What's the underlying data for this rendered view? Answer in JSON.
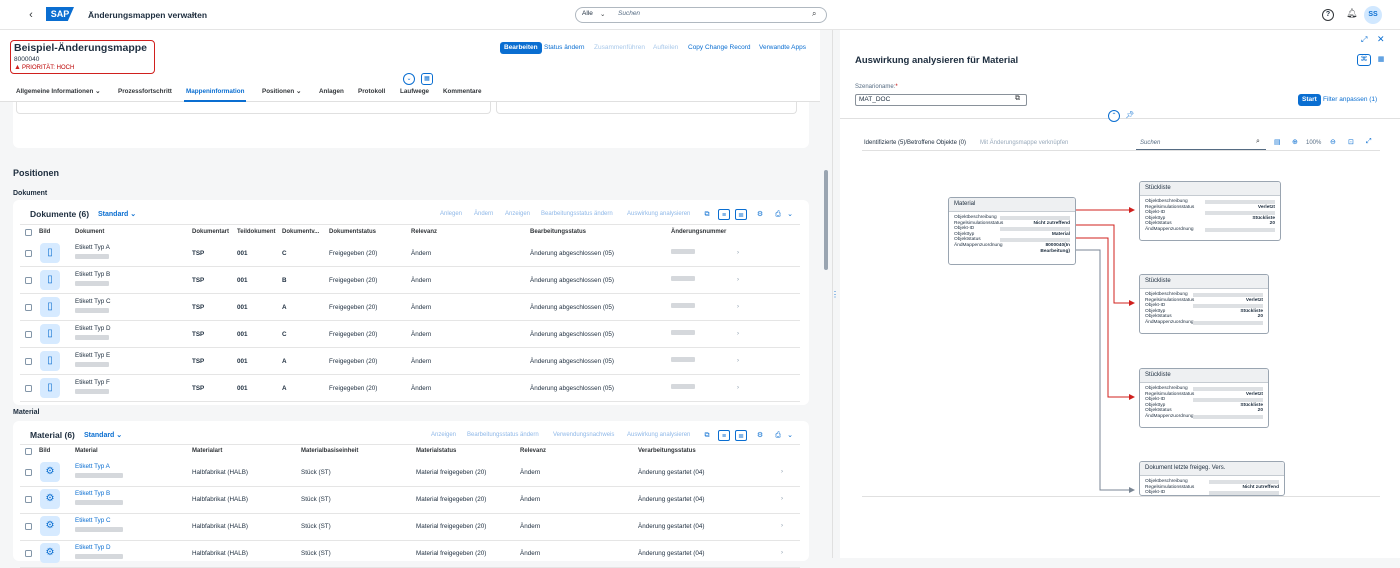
{
  "shell": {
    "app_title": "Änderungsmappen verwalten",
    "search_scope": "Alle",
    "search_placeholder": "Suchen",
    "avatar": "SS",
    "logo": "SAP"
  },
  "header": {
    "title": "Beispiel-Änderungsmappe",
    "number": "8000040",
    "priority": "PRIORITÄT: HOCH",
    "actions": [
      "Bearbeiten",
      "Status ändern",
      "Zusammenführen",
      "Aufteilen",
      "Copy Change Record",
      "Verwandte Apps"
    ]
  },
  "tabs": [
    "Allgemeine Informationen",
    "Prozessfortschritt",
    "Mappeninformation",
    "Positionen",
    "Anlagen",
    "Protokoll",
    "Laufwege",
    "Kommentare"
  ],
  "positions": {
    "section_title": "Positionen",
    "doc_subtitle": "Dokument",
    "mat_subtitle": "Material"
  },
  "documents": {
    "title": "Dokumente (6)",
    "variant": "Standard",
    "actions": [
      "Anlegen",
      "Ändern",
      "Anzeigen",
      "Bearbeitungsstatus ändern",
      "Auswirkung analysieren"
    ],
    "columns": [
      "Bild",
      "Dokument",
      "Dokumentart",
      "Teildokument",
      "Dokumentv...",
      "Dokumentstatus",
      "Relevanz",
      "Bearbeitungsstatus",
      "Änderungsnummer"
    ],
    "rows": [
      {
        "name": "Etikett Typ A",
        "art": "TSP",
        "teil": "001",
        "version": "C",
        "status": "Freigegeben (20)",
        "relevanz": "Ändern",
        "bearb": "Änderung abgeschlossen (05)"
      },
      {
        "name": "Etikett Typ B",
        "art": "TSP",
        "teil": "001",
        "version": "B",
        "status": "Freigegeben (20)",
        "relevanz": "Ändern",
        "bearb": "Änderung abgeschlossen (05)"
      },
      {
        "name": "Etikett Typ C",
        "art": "TSP",
        "teil": "001",
        "version": "A",
        "status": "Freigegeben (20)",
        "relevanz": "Ändern",
        "bearb": "Änderung abgeschlossen (05)"
      },
      {
        "name": "Etikett Typ D",
        "art": "TSP",
        "teil": "001",
        "version": "C",
        "status": "Freigegeben (20)",
        "relevanz": "Ändern",
        "bearb": "Änderung abgeschlossen (05)"
      },
      {
        "name": "Etikett Typ E",
        "art": "TSP",
        "teil": "001",
        "version": "A",
        "status": "Freigegeben (20)",
        "relevanz": "Ändern",
        "bearb": "Änderung abgeschlossen (05)"
      },
      {
        "name": "Etikett Typ F",
        "art": "TSP",
        "teil": "001",
        "version": "A",
        "status": "Freigegeben (20)",
        "relevanz": "Ändern",
        "bearb": "Änderung abgeschlossen (05)"
      }
    ]
  },
  "materials": {
    "title": "Material (6)",
    "variant": "Standard",
    "actions": [
      "Anzeigen",
      "Bearbeitungsstatus ändern",
      "Verwendungsnachweis",
      "Auswirkung analysieren"
    ],
    "columns": [
      "Bild",
      "Material",
      "Materialart",
      "Materialbasiseinheit",
      "Materialstatus",
      "Relevanz",
      "Verarbeitungsstatus"
    ],
    "rows": [
      {
        "name": "Etikett Typ A",
        "art": "Halbfabrikat (HALB)",
        "unit": "Stück (ST)",
        "status": "Material freigegeben (20)",
        "relevanz": "Ändern",
        "proc": "Änderung gestartet (04)"
      },
      {
        "name": "Etikett Typ B",
        "art": "Halbfabrikat (HALB)",
        "unit": "Stück (ST)",
        "status": "Material freigegeben (20)",
        "relevanz": "Ändern",
        "proc": "Änderung gestartet (04)"
      },
      {
        "name": "Etikett Typ C",
        "art": "Halbfabrikat (HALB)",
        "unit": "Stück (ST)",
        "status": "Material freigegeben (20)",
        "relevanz": "Ändern",
        "proc": "Änderung gestartet (04)"
      },
      {
        "name": "Etikett Typ D",
        "art": "Halbfabrikat (HALB)",
        "unit": "Stück (ST)",
        "status": "Material freigegeben (20)",
        "relevanz": "Ändern",
        "proc": "Änderung gestartet (04)"
      }
    ]
  },
  "impact": {
    "title": "Auswirkung analysieren für Material",
    "scenario_label": "Szenarioname:",
    "scenario_required": "*",
    "scenario_value": "MAT_DOC",
    "start": "Start",
    "filter": "Filter anpassen (1)",
    "tab_identified": "Identifizierte (5)/Betroffene Objekte (0)",
    "tab_link": "Mit Änderungsmappe verknüpfen",
    "graph_search": "Suchen",
    "zoom": "100%",
    "nodes": {
      "material": {
        "title": "Material",
        "rows": [
          {
            "label": "Objektbeschreibung",
            "value": ""
          },
          {
            "label": "Regelsimulationsstatus",
            "value": "Nicht zutreffend"
          },
          {
            "label": "Objekt-ID",
            "value": ""
          },
          {
            "label": "Objekttyp",
            "value": "Material"
          },
          {
            "label": "Objektstatus",
            "value": ""
          },
          {
            "label": "ÄndMappenzuordnung",
            "value": "8000040(In"
          },
          {
            "label": "",
            "value": "Bearbeitung)"
          }
        ]
      },
      "bom1": {
        "title": "Stückliste",
        "rows": [
          {
            "label": "Objektbeschreibung",
            "value": ""
          },
          {
            "label": "Regelsimulationsstatus",
            "value": "Verletzt"
          },
          {
            "label": "Objekt-ID",
            "value": ""
          },
          {
            "label": "Objekttyp",
            "value": "Stückliste"
          },
          {
            "label": "Objektstatus",
            "value": "20"
          },
          {
            "label": "ÄndMappenzuordnung",
            "value": ""
          }
        ]
      },
      "bom2": {
        "title": "Stückliste",
        "rows": [
          {
            "label": "Objektbeschreibung",
            "value": ""
          },
          {
            "label": "Regelsimulationsstatus",
            "value": "Verletzt"
          },
          {
            "label": "Objekt-ID",
            "value": ""
          },
          {
            "label": "Objekttyp",
            "value": "Stückliste"
          },
          {
            "label": "Objektstatus",
            "value": "20"
          },
          {
            "label": "ÄndMappenzuordnung",
            "value": ""
          }
        ]
      },
      "bom3": {
        "title": "Stückliste",
        "rows": [
          {
            "label": "Objektbeschreibung",
            "value": ""
          },
          {
            "label": "Regelsimulationsstatus",
            "value": "Verletzt"
          },
          {
            "label": "Objekt-ID",
            "value": ""
          },
          {
            "label": "Objekttyp",
            "value": "Stückliste"
          },
          {
            "label": "Objektstatus",
            "value": "20"
          },
          {
            "label": "ÄndMappenzuordnung",
            "value": ""
          }
        ]
      },
      "doc": {
        "title": "Dokument letzte freigeg. Vers.",
        "rows": [
          {
            "label": "Objektbeschreibung",
            "value": ""
          },
          {
            "label": "Regelsimulationsstatus",
            "value": "Nicht zutreffend"
          },
          {
            "label": "Objekt-ID",
            "value": ""
          }
        ]
      }
    }
  },
  "colors": {
    "accent": "#0a6ed1",
    "violation": "#d0201e",
    "neutral_edge": "#7a8694"
  }
}
